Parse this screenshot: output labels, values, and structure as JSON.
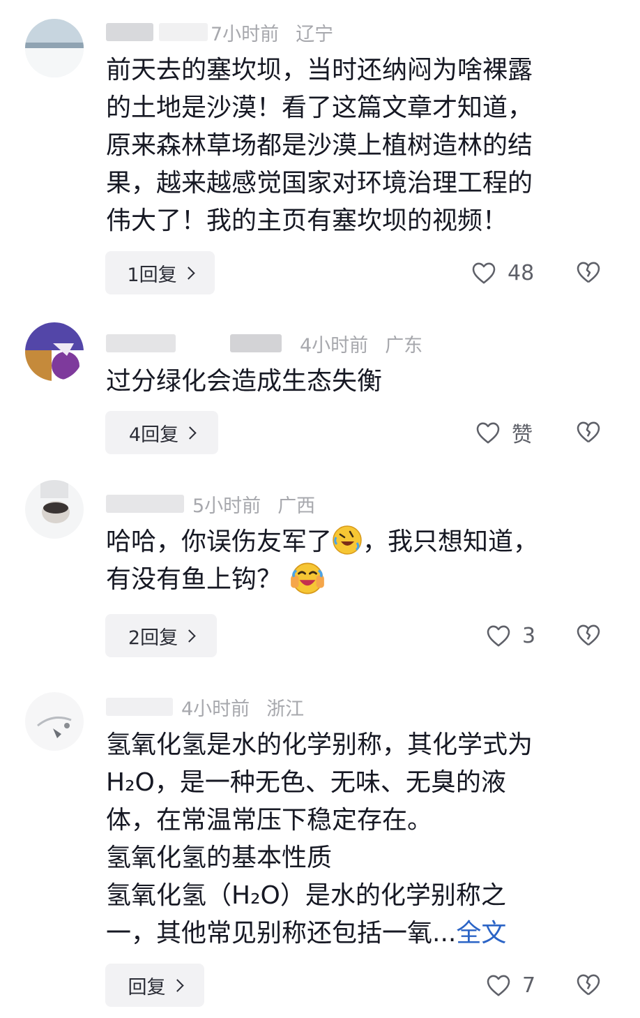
{
  "comments": [
    {
      "time": "7小时前",
      "location": "辽宁",
      "lines": [
        "前天去的塞坎坝，当时还纳闷为啥裸露",
        "的土地是沙漠！看了这篇文章才知道，",
        "原来森林草场都是沙漠上植树造林的结",
        "果，越来越感觉国家对环境治理工程的",
        "伟大了！我的主页有塞坎坝的视频！"
      ],
      "reply_label": "1回复",
      "likes": "48"
    },
    {
      "time": "4小时前",
      "location": "广东",
      "lines": [
        "过分绿化会造成生态失衡"
      ],
      "reply_label": "4回复",
      "likes": "赞"
    },
    {
      "time": "5小时前",
      "location": "广西",
      "line1_a": "哈哈，你误伤友军了",
      "line1_b": "，我只想知道，",
      "line2": "有没有鱼上钩？",
      "reply_label": "2回复",
      "likes": "3"
    },
    {
      "time": "4小时前",
      "location": "浙江",
      "lines": [
        "氢氧化氢是水的化学别称，其化学式为",
        "H₂O，是一种无色、无味、无臭的液",
        "体，在常温常压下稳定存在。",
        "氢氧化氢的基本性质",
        "氢氧化氢（H₂O）是水的化学别称之"
      ],
      "last_line": "一，其他常见别称还包括一氧...",
      "more_label": "全文",
      "reply_label": "回复",
      "likes": "7"
    }
  ],
  "icons": {
    "like": "heart-outline-icon",
    "dislike": "broken-heart-icon",
    "emoji_1": "rolling-laugh-emoji",
    "emoji_2": "tears-of-joy-emoji"
  },
  "colors": {
    "text": "#161823",
    "meta": "#a7a8ad",
    "link": "#2b64c6",
    "reply_bg": "#f2f2f4"
  }
}
